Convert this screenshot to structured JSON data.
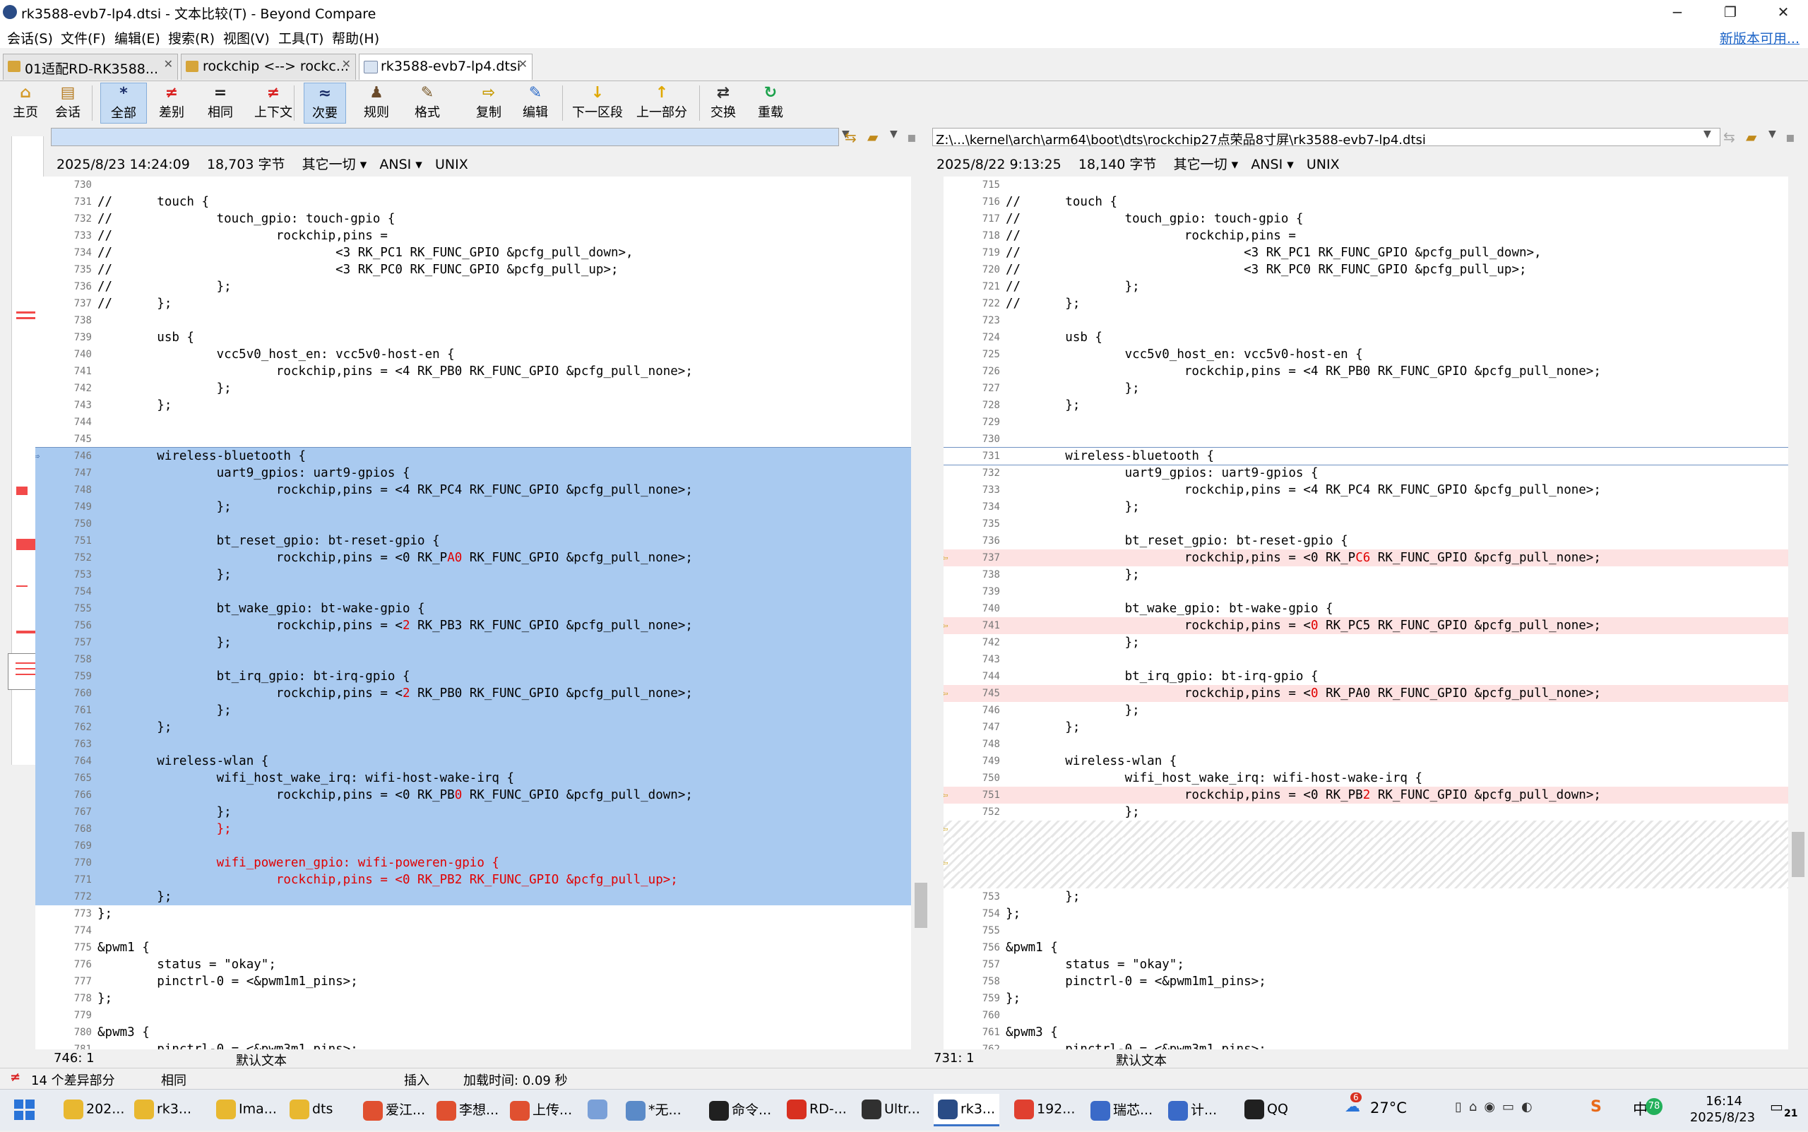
{
  "window": {
    "title": "rk3588-evb7-lp4.dtsi - 文本比较(T) - Beyond Compare",
    "controls": [
      "−",
      "❐",
      "✕"
    ]
  },
  "menu": {
    "items": [
      "会话(S)",
      "文件(F)",
      "编辑(E)",
      "搜索(R)",
      "视图(V)",
      "工具(T)",
      "帮助(H)"
    ],
    "new_version": "新版本可用..."
  },
  "tabs": [
    {
      "label": "01适配RD-RK3588...",
      "close": "✕"
    },
    {
      "label": "rockchip <--> rockc...",
      "close": "✕"
    },
    {
      "label": "rk3588-evb7-lp4.dtsi",
      "close": "✕"
    }
  ],
  "toolbar": [
    {
      "label": "主页",
      "icon": "⌂",
      "color": "#d49a2a"
    },
    {
      "label": "会话",
      "icon": "▤",
      "color": "#b57a1e"
    },
    {
      "label": "全部",
      "icon": "*",
      "color": "#1c2f6a"
    },
    {
      "label": "差别",
      "icon": "≠",
      "color": "#d92020"
    },
    {
      "label": "相同",
      "icon": "=",
      "color": "#222222"
    },
    {
      "label": "上下文",
      "icon": "≠",
      "color": "#d92020"
    },
    {
      "label": "次要",
      "icon": "≈",
      "color": "#1c2f6a"
    },
    {
      "label": "规则",
      "icon": "♟",
      "color": "#6a4a2a"
    },
    {
      "label": "格式",
      "icon": "✎",
      "color": "#7a5a2a"
    },
    {
      "label": "复制",
      "icon": "⇨",
      "color": "#c79a00"
    },
    {
      "label": "编辑",
      "icon": "✎",
      "color": "#2a6ac8"
    },
    {
      "label": "下一区段",
      "icon": "↓",
      "color": "#e0a800"
    },
    {
      "label": "上一部分",
      "icon": "↑",
      "color": "#e0a800"
    },
    {
      "label": "交换",
      "icon": "⇄",
      "color": "#333333"
    },
    {
      "label": "重载",
      "icon": "↻",
      "color": "#1aa14a"
    }
  ],
  "left": {
    "path": "",
    "date": "2025/8/23 14:24:09",
    "size": "18,703 字节",
    "filter": "其它一切",
    "encoding": "ANSI",
    "eol": "UNIX",
    "cursor": "746: 1",
    "format": "默认文本"
  },
  "right": {
    "path": "Z:\\...\\kernel\\arch\\arm64\\boot\\dts\\rockchip27点荣品8寸屏\\rk3588-evb7-lp4.dtsi",
    "date": "2025/8/22 9:13:25",
    "size": "18,140 字节",
    "filter": "其它一切",
    "encoding": "ANSI",
    "eol": "UNIX",
    "cursor": "731: 1",
    "format": "默认文本"
  },
  "left_lines": [
    {
      "n": "730",
      "t": ""
    },
    {
      "n": "731",
      "t": "//      touch {"
    },
    {
      "n": "732",
      "t": "//              touch_gpio: touch-gpio {"
    },
    {
      "n": "733",
      "t": "//                      rockchip,pins ="
    },
    {
      "n": "734",
      "t": "//                              <3 RK_PC1 RK_FUNC_GPIO &pcfg_pull_down>,"
    },
    {
      "n": "735",
      "t": "//                              <3 RK_PC0 RK_FUNC_GPIO &pcfg_pull_up>;"
    },
    {
      "n": "736",
      "t": "//              };"
    },
    {
      "n": "737",
      "t": "//      };"
    },
    {
      "n": "738",
      "t": ""
    },
    {
      "n": "739",
      "t": "        usb {"
    },
    {
      "n": "740",
      "t": "                vcc5v0_host_en: vcc5v0-host-en {"
    },
    {
      "n": "741",
      "t": "                        rockchip,pins = <4 RK_PB0 RK_FUNC_GPIO &pcfg_pull_none>;"
    },
    {
      "n": "742",
      "t": "                };"
    },
    {
      "n": "743",
      "t": "        };"
    },
    {
      "n": "744",
      "t": ""
    },
    {
      "n": "745",
      "t": ""
    },
    {
      "n": "746",
      "t": "        wireless-bluetooth {",
      "hl": true,
      "cur": true
    },
    {
      "n": "747",
      "t": "                uart9_gpios: uart9-gpios {",
      "hl": true
    },
    {
      "n": "748",
      "t": "                        rockchip,pins = <4 RK_PC4 RK_FUNC_GPIO &pcfg_pull_none>;",
      "hl": true
    },
    {
      "n": "749",
      "t": "                };",
      "hl": true
    },
    {
      "n": "750",
      "t": "",
      "hl": true
    },
    {
      "n": "751",
      "t": "                bt_reset_gpio: bt-reset-gpio {",
      "hl": true
    },
    {
      "n": "752",
      "pre": "                        rockchip,pins = <0 RK_P",
      "diff": "A0",
      "post": " RK_FUNC_GPIO &pcfg_pull_none>;",
      "hl": true
    },
    {
      "n": "753",
      "t": "                };",
      "hl": true
    },
    {
      "n": "754",
      "t": "",
      "hl": true
    },
    {
      "n": "755",
      "t": "                bt_wake_gpio: bt-wake-gpio {",
      "hl": true
    },
    {
      "n": "756",
      "pre": "                        rockchip,pins = <",
      "diff": "2",
      "post": " RK_PB3 RK_FUNC_GPIO &pcfg_pull_none>;",
      "hl": true
    },
    {
      "n": "757",
      "t": "                };",
      "hl": true
    },
    {
      "n": "758",
      "t": "",
      "hl": true
    },
    {
      "n": "759",
      "t": "                bt_irq_gpio: bt-irq-gpio {",
      "hl": true
    },
    {
      "n": "760",
      "pre": "                        rockchip,pins = <",
      "diff": "2",
      "post": " RK_PB0 RK_FUNC_GPIO &pcfg_pull_none>;",
      "hl": true
    },
    {
      "n": "761",
      "t": "                };",
      "hl": true
    },
    {
      "n": "762",
      "t": "        };",
      "hl": true
    },
    {
      "n": "763",
      "t": "",
      "hl": true
    },
    {
      "n": "764",
      "t": "        wireless-wlan {",
      "hl": true
    },
    {
      "n": "765",
      "t": "                wifi_host_wake_irq: wifi-host-wake-irq {",
      "hl": true
    },
    {
      "n": "766",
      "pre": "                        rockchip,pins = <0 RK_PB",
      "diff": "0",
      "post": " RK_FUNC_GPIO &pcfg_pull_down>;",
      "hl": true
    },
    {
      "n": "767",
      "t": "                };",
      "hl": true
    },
    {
      "n": "768",
      "t": "                };",
      "hl": true,
      "red": true
    },
    {
      "n": "769",
      "t": "",
      "hl": true
    },
    {
      "n": "770",
      "t": "                wifi_poweren_gpio: wifi-poweren-gpio {",
      "hl": true,
      "red": true
    },
    {
      "n": "771",
      "t": "                        rockchip,pins = <0 RK_PB2 RK_FUNC_GPIO &pcfg_pull_up>;",
      "hl": true,
      "red": true
    },
    {
      "n": "772",
      "t": "        };",
      "hl": true
    },
    {
      "n": "773",
      "t": "};"
    },
    {
      "n": "774",
      "t": ""
    },
    {
      "n": "775",
      "t": "&pwm1 {"
    },
    {
      "n": "776",
      "t": "        status = \"okay\";"
    },
    {
      "n": "777",
      "t": "        pinctrl-0 = <&pwm1m1_pins>;"
    },
    {
      "n": "778",
      "t": "};"
    },
    {
      "n": "779",
      "t": ""
    },
    {
      "n": "780",
      "t": "&pwm3 {"
    },
    {
      "n": "781",
      "t": "        pinctrl-0 = <&pwm3m1_pins>;"
    }
  ],
  "right_lines": [
    {
      "n": "715",
      "t": ""
    },
    {
      "n": "716",
      "t": "//      touch {"
    },
    {
      "n": "717",
      "t": "//              touch_gpio: touch-gpio {"
    },
    {
      "n": "718",
      "t": "//                      rockchip,pins ="
    },
    {
      "n": "719",
      "t": "//                              <3 RK_PC1 RK_FUNC_GPIO &pcfg_pull_down>,"
    },
    {
      "n": "720",
      "t": "//                              <3 RK_PC0 RK_FUNC_GPIO &pcfg_pull_up>;"
    },
    {
      "n": "721",
      "t": "//              };"
    },
    {
      "n": "722",
      "t": "//      };"
    },
    {
      "n": "723",
      "t": ""
    },
    {
      "n": "724",
      "t": "        usb {"
    },
    {
      "n": "725",
      "t": "                vcc5v0_host_en: vcc5v0-host-en {"
    },
    {
      "n": "726",
      "t": "                        rockchip,pins = <4 RK_PB0 RK_FUNC_GPIO &pcfg_pull_none>;"
    },
    {
      "n": "727",
      "t": "                };"
    },
    {
      "n": "728",
      "t": "        };"
    },
    {
      "n": "729",
      "t": ""
    },
    {
      "n": "730",
      "t": ""
    },
    {
      "n": "731",
      "t": "        wireless-bluetooth {",
      "cur": true
    },
    {
      "n": "732",
      "t": "                uart9_gpios: uart9-gpios {"
    },
    {
      "n": "733",
      "t": "                        rockchip,pins = <4 RK_PC4 RK_FUNC_GPIO &pcfg_pull_none>;"
    },
    {
      "n": "734",
      "t": "                };"
    },
    {
      "n": "735",
      "t": ""
    },
    {
      "n": "736",
      "t": "                bt_reset_gpio: bt-reset-gpio {"
    },
    {
      "n": "737",
      "pre": "                        rockchip,pins = <0 RK_P",
      "diff": "C6",
      "post": " RK_FUNC_GPIO &pcfg_pull_none>;",
      "diffrow": true
    },
    {
      "n": "738",
      "t": "                };"
    },
    {
      "n": "739",
      "t": ""
    },
    {
      "n": "740",
      "t": "                bt_wake_gpio: bt-wake-gpio {"
    },
    {
      "n": "741",
      "pre": "                        rockchip,pins = <",
      "diff": "0",
      "post": " RK_PC5 RK_FUNC_GPIO &pcfg_pull_none>;",
      "diffrow": true
    },
    {
      "n": "742",
      "t": "                };"
    },
    {
      "n": "743",
      "t": ""
    },
    {
      "n": "744",
      "t": "                bt_irq_gpio: bt-irq-gpio {"
    },
    {
      "n": "745",
      "pre": "                        rockchip,pins = <",
      "diff": "0",
      "post": " RK_PA0 RK_FUNC_GPIO &pcfg_pull_none>;",
      "diffrow": true
    },
    {
      "n": "746",
      "t": "                };"
    },
    {
      "n": "747",
      "t": "        };"
    },
    {
      "n": "748",
      "t": ""
    },
    {
      "n": "749",
      "t": "        wireless-wlan {"
    },
    {
      "n": "750",
      "t": "                wifi_host_wake_irq: wifi-host-wake-irq {"
    },
    {
      "n": "751",
      "pre": "                        rockchip,pins = <0 RK_PB",
      "diff": "2",
      "post": " RK_FUNC_GPIO &pcfg_pull_down>;",
      "diffrow": true
    },
    {
      "n": "752",
      "t": "                };"
    },
    {
      "n": "",
      "t": "",
      "gap": true
    },
    {
      "n": "",
      "t": "",
      "gap": true
    },
    {
      "n": "",
      "t": "",
      "gap": true
    },
    {
      "n": "",
      "t": "",
      "gap": true
    },
    {
      "n": "753",
      "t": "        };"
    },
    {
      "n": "754",
      "t": "};"
    },
    {
      "n": "755",
      "t": ""
    },
    {
      "n": "756",
      "t": "&pwm1 {"
    },
    {
      "n": "757",
      "t": "        status = \"okay\";"
    },
    {
      "n": "758",
      "t": "        pinctrl-0 = <&pwm1m1_pins>;"
    },
    {
      "n": "759",
      "t": "};"
    },
    {
      "n": "760",
      "t": ""
    },
    {
      "n": "761",
      "t": "&pwm3 {"
    },
    {
      "n": "762",
      "t": "        pinctrl-0 = <&pwm3m1_pins>;"
    }
  ],
  "status": {
    "diff_count": "14 个差异部分",
    "same": "相同",
    "mode": "插入",
    "load_time": "加载时间: 0.09 秒"
  },
  "taskbar": {
    "items": [
      {
        "label": "202...",
        "color": "#e8b830"
      },
      {
        "label": "rk3...",
        "color": "#e8b830"
      },
      {
        "label": "Ima...",
        "color": "#e8b830"
      },
      {
        "label": "dts",
        "color": "#e8b830"
      },
      {
        "label": "爱江...",
        "color": "#e05030"
      },
      {
        "label": "李想...",
        "color": "#e05030"
      },
      {
        "label": "上传...",
        "color": "#e05030"
      },
      {
        "label": "",
        "color": "#7aa0d8"
      },
      {
        "label": "*无...",
        "color": "#5a8ac8"
      },
      {
        "label": "命令...",
        "color": "#202020"
      },
      {
        "label": "RD-...",
        "color": "#d83020"
      },
      {
        "label": "Ultr...",
        "color": "#303030"
      },
      {
        "label": "rk3...",
        "color": "#2a4c86"
      },
      {
        "label": "192...",
        "color": "#e04030"
      },
      {
        "label": "瑞芯...",
        "color": "#3a6ac8"
      },
      {
        "label": "计...",
        "color": "#3a6ac8"
      },
      {
        "label": "QQ",
        "color": "#202020"
      }
    ],
    "weather": "27°C",
    "weather_badge": "6",
    "ime": "中",
    "time": "16:14",
    "date": "2025/8/23",
    "notifications": "21",
    "badge": "78"
  }
}
